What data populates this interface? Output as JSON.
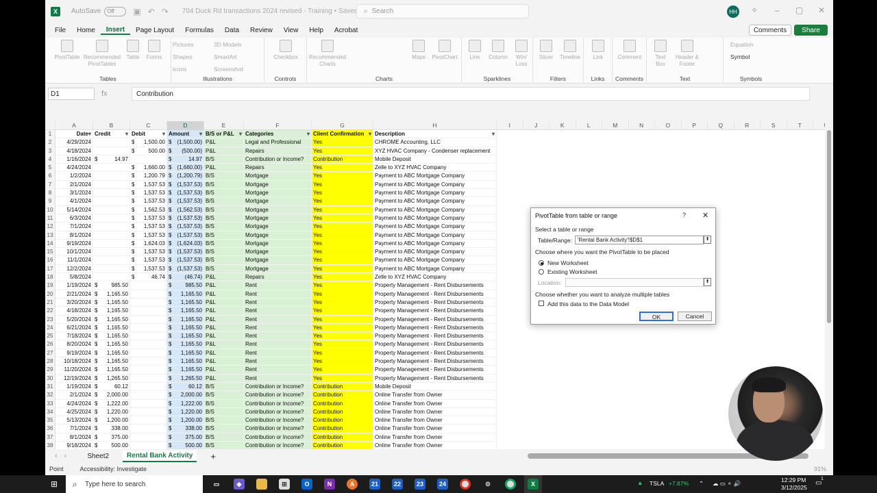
{
  "titlebar": {
    "autosave": "AutoSave",
    "toggle": "Off",
    "doc_title": "704 Duck Rd transactions 2024 revised - Training • Saved",
    "search_placeholder": "Search",
    "avatar": "HH"
  },
  "menu": [
    "File",
    "Home",
    "Insert",
    "Page Layout",
    "Formulas",
    "Data",
    "Review",
    "View",
    "Help",
    "Acrobat"
  ],
  "menu_active": "Insert",
  "actions": {
    "comments": "Comments",
    "share": "Share"
  },
  "ribbon": {
    "groups": [
      "Tables",
      "Illustrations",
      "Controls",
      "Charts",
      "Sparklines",
      "Filters",
      "Links",
      "Comments",
      "Text",
      "Symbols"
    ],
    "tables": [
      "PivotTable",
      "Recommended PivotTables",
      "Table",
      "Forms"
    ],
    "illustrations": [
      "Pictures",
      "Shapes",
      "Icons",
      "3D Models",
      "SmartArt",
      "Screenshot"
    ],
    "controls": [
      "Checkbox"
    ],
    "charts": [
      "Recommended Charts",
      "Maps",
      "PivotChart"
    ],
    "sparklines": [
      "Line",
      "Column",
      "Win/ Loss"
    ],
    "filters": [
      "Slicer",
      "Timeline"
    ],
    "links": [
      "Link"
    ],
    "comments": [
      "Comment"
    ],
    "text": [
      "Text Box",
      "Header & Footer"
    ],
    "symbols": [
      "Equation",
      "Symbol"
    ]
  },
  "formula": {
    "namebox": "D1",
    "fx": "fx",
    "content": "Contribution"
  },
  "columns": [
    "A",
    "B",
    "C",
    "D",
    "E",
    "F",
    "G",
    "H",
    "I",
    "J",
    "K",
    "L",
    "M",
    "N",
    "O",
    "P",
    "Q",
    "R",
    "S",
    "T",
    "U"
  ],
  "headers": [
    "Date",
    "Credit",
    "Debit",
    "Amount",
    "B/S or P&L",
    "Categories",
    "Client Confirmation",
    "Description"
  ],
  "rows": [
    [
      "4/29/2024",
      "",
      "1,500.00",
      "(1,500.00)",
      "P&L",
      "Legal and Professional",
      "Yes",
      "CHROME Accounting, LLC"
    ],
    [
      "4/18/2024",
      "",
      "500.00",
      "(500.00)",
      "P&L",
      "Repairs",
      "Yes",
      "XYZ HVAC Company - Condenser replacement"
    ],
    [
      "1/16/2024",
      "14.97",
      "",
      "14.97",
      "B/S",
      "Contribution or Income?",
      "Contribution",
      "Mobile Deposit"
    ],
    [
      "4/24/2024",
      "",
      "1,660.00",
      "(1,660.00)",
      "P&L",
      "Repairs",
      "Yes",
      "Zelle to XYZ HVAC Company"
    ],
    [
      "1/2/2024",
      "",
      "1,200.79",
      "(1,200.79)",
      "B/S",
      "Mortgage",
      "Yes",
      "Payment to ABC Mortgage Company"
    ],
    [
      "2/1/2024",
      "",
      "1,537.53",
      "(1,537.53)",
      "B/S",
      "Mortgage",
      "Yes",
      "Payment to ABC Mortgage Company"
    ],
    [
      "3/1/2024",
      "",
      "1,537.53",
      "(1,537.53)",
      "B/S",
      "Mortgage",
      "Yes",
      "Payment to ABC Mortgage Company"
    ],
    [
      "4/1/2024",
      "",
      "1,537.53",
      "(1,537.53)",
      "B/S",
      "Mortgage",
      "Yes",
      "Payment to ABC Mortgage Company"
    ],
    [
      "5/14/2024",
      "",
      "1,562.53",
      "(1,562.53)",
      "B/S",
      "Mortgage",
      "Yes",
      "Payment to ABC Mortgage Company"
    ],
    [
      "6/3/2024",
      "",
      "1,537.53",
      "(1,537.53)",
      "B/S",
      "Mortgage",
      "Yes",
      "Payment to ABC Mortgage Company"
    ],
    [
      "7/1/2024",
      "",
      "1,537.53",
      "(1,537.53)",
      "B/S",
      "Mortgage",
      "Yes",
      "Payment to ABC Mortgage Company"
    ],
    [
      "8/1/2024",
      "",
      "1,537.53",
      "(1,537.53)",
      "B/S",
      "Mortgage",
      "Yes",
      "Payment to ABC Mortgage Company"
    ],
    [
      "9/19/2024",
      "",
      "1,624.03",
      "(1,624.03)",
      "B/S",
      "Mortgage",
      "Yes",
      "Payment to ABC Mortgage Company"
    ],
    [
      "10/1/2024",
      "",
      "1,537.53",
      "(1,537.53)",
      "B/S",
      "Mortgage",
      "Yes",
      "Payment to ABC Mortgage Company"
    ],
    [
      "11/1/2024",
      "",
      "1,537.53",
      "(1,537.53)",
      "B/S",
      "Mortgage",
      "Yes",
      "Payment to ABC Mortgage Company"
    ],
    [
      "12/2/2024",
      "",
      "1,537.53",
      "(1,537.53)",
      "B/S",
      "Mortgage",
      "Yes",
      "Payment to ABC Mortgage Company"
    ],
    [
      "5/8/2024",
      "",
      "46.74",
      "(46.74)",
      "P&L",
      "Repairs",
      "Yes",
      "Zelle to XYZ HVAC Company"
    ],
    [
      "1/19/2024",
      "985.50",
      "",
      "985.50",
      "P&L",
      "Rent",
      "Yes",
      "Property Management - Rent Disbursements"
    ],
    [
      "2/21/2024",
      "1,165.50",
      "",
      "1,165.50",
      "P&L",
      "Rent",
      "Yes",
      "Property Management - Rent Disbursements"
    ],
    [
      "3/20/2024",
      "1,165.50",
      "",
      "1,165.50",
      "P&L",
      "Rent",
      "Yes",
      "Property Management - Rent Disbursements"
    ],
    [
      "4/18/2024",
      "1,165.50",
      "",
      "1,165.50",
      "P&L",
      "Rent",
      "Yes",
      "Property Management - Rent Disbursements"
    ],
    [
      "5/20/2024",
      "1,165.50",
      "",
      "1,165.50",
      "P&L",
      "Rent",
      "Yes",
      "Property Management - Rent Disbursements"
    ],
    [
      "6/21/2024",
      "1,165.50",
      "",
      "1,165.50",
      "P&L",
      "Rent",
      "Yes",
      "Property Management - Rent Disbursements"
    ],
    [
      "7/18/2024",
      "1,165.50",
      "",
      "1,165.50",
      "P&L",
      "Rent",
      "Yes",
      "Property Management - Rent Disbursements"
    ],
    [
      "8/20/2024",
      "1,165.50",
      "",
      "1,165.50",
      "P&L",
      "Rent",
      "Yes",
      "Property Management - Rent Disbursements"
    ],
    [
      "9/19/2024",
      "1,165.50",
      "",
      "1,165.50",
      "P&L",
      "Rent",
      "Yes",
      "Property Management - Rent Disbursements"
    ],
    [
      "10/18/2024",
      "1,165.50",
      "",
      "1,165.50",
      "P&L",
      "Rent",
      "Yes",
      "Property Management - Rent Disbursements"
    ],
    [
      "11/20/2024",
      "1,165.50",
      "",
      "1,165.50",
      "P&L",
      "Rent",
      "Yes",
      "Property Management - Rent Disbursements"
    ],
    [
      "12/19/2024",
      "1,265.50",
      "",
      "1,265.50",
      "P&L",
      "Rent",
      "Yes",
      "Property Management - Rent Disbursements"
    ],
    [
      "1/19/2024",
      "60.12",
      "",
      "60.12",
      "B/S",
      "Contribution or Income?",
      "Contribution",
      "Mobile Deposit"
    ],
    [
      "2/1/2024",
      "2,000.00",
      "",
      "2,000.00",
      "B/S",
      "Contribution or Income?",
      "Contribution",
      "Online Transfer from Owner"
    ],
    [
      "4/24/2024",
      "1,222.00",
      "",
      "1,222.00",
      "B/S",
      "Contribution or Income?",
      "Contribution",
      "Online Transfer from Owner"
    ],
    [
      "4/25/2024",
      "1,220.00",
      "",
      "1,220.00",
      "B/S",
      "Contribution or Income?",
      "Contribution",
      "Online Transfer from Owner"
    ],
    [
      "5/13/2024",
      "1,200.00",
      "",
      "1,200.00",
      "B/S",
      "Contribution or Income?",
      "Contribution",
      "Online Transfer from Owner"
    ],
    [
      "7/1/2024",
      "338.00",
      "",
      "338.00",
      "B/S",
      "Contribution or Income?",
      "Contribution",
      "Online Transfer from Owner"
    ],
    [
      "8/1/2024",
      "375.00",
      "",
      "375.00",
      "B/S",
      "Contribution or Income?",
      "Contribution",
      "Online Transfer from Owner"
    ],
    [
      "9/18/2024",
      "500.00",
      "",
      "500.00",
      "B/S",
      "Contribution or Income?",
      "Contribution",
      "Online Transfer from Owner"
    ]
  ],
  "sheets": [
    "Sheet2",
    "Rental Bank Activity"
  ],
  "active_sheet": "Rental Bank Activity",
  "status": {
    "mode": "Point",
    "accessibility": "Accessibility: Investigate",
    "zoom": "91%"
  },
  "dialog": {
    "title": "PivotTable from table or range",
    "help": "?",
    "section1": "Select a table or range",
    "table_range_label": "Table/Range:",
    "table_range_value": "'Rental Bank Activity'!$D$1",
    "section2": "Choose where you want the PivotTable to be placed",
    "opt_new": "New Worksheet",
    "opt_existing": "Existing Worksheet",
    "location_label": "Location:",
    "section3": "Choose whether you want to analyze multiple tables",
    "data_model": "Add this data to the Data Model",
    "ok": "OK",
    "cancel": "Cancel"
  },
  "taskbar": {
    "search": "Type here to search",
    "badges": [
      "21",
      "22",
      "23",
      "24"
    ],
    "ticker": "TSLA",
    "ticker_change": "+7.87%",
    "time": "12:29 PM",
    "date": "3/12/2025",
    "notif": "1"
  }
}
